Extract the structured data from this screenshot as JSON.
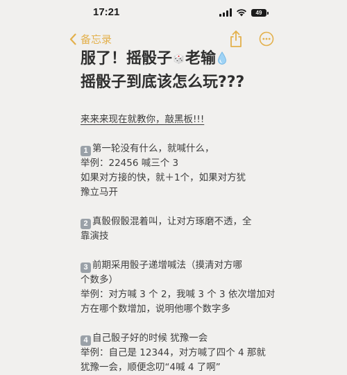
{
  "status_bar": {
    "time": "17:21",
    "battery_level": "49"
  },
  "nav": {
    "back_label": "备忘录"
  },
  "note": {
    "title_line1_a": "服了！摇骰子",
    "title_line1_b": "老输",
    "title_line2": "摇骰子到底该怎么玩???",
    "intro": "来来来现在就教你，敲黑板!!!",
    "tips": [
      {
        "num": "1",
        "lines": [
          "第一轮没有什么，就喊什么，",
          "举例：22456 喊三个 3",
          "如果对方接的快，就＋1个，如果对方犹",
          "豫立马开"
        ]
      },
      {
        "num": "2",
        "lines": [
          "真骰假骰混着叫，让对方琢磨不透，全",
          "靠演技"
        ]
      },
      {
        "num": "3",
        "lines": [
          "前期采用骰子递增喊法（摸清对方哪",
          "个数多）",
          "举例：对方喊 3 个 2，我喊 3 个 3 依次增加对",
          "方在哪个数增加，说明他哪个数字多"
        ]
      },
      {
        "num": "4",
        "lines": [
          "自己骰子好的时候 犹豫一会",
          "举例：自己是 12344，对方喊了四个 4 那就",
          "犹豫一会，顺便念叨“4喊 4 了啊”"
        ]
      }
    ]
  },
  "colors": {
    "accent": "#e3b04b",
    "background": "#f1f0ee",
    "badge": "#9aa1a8"
  },
  "icons": [
    "back-chevron-icon",
    "share-icon",
    "more-icon",
    "dice-icon",
    "droplet-icon"
  ]
}
